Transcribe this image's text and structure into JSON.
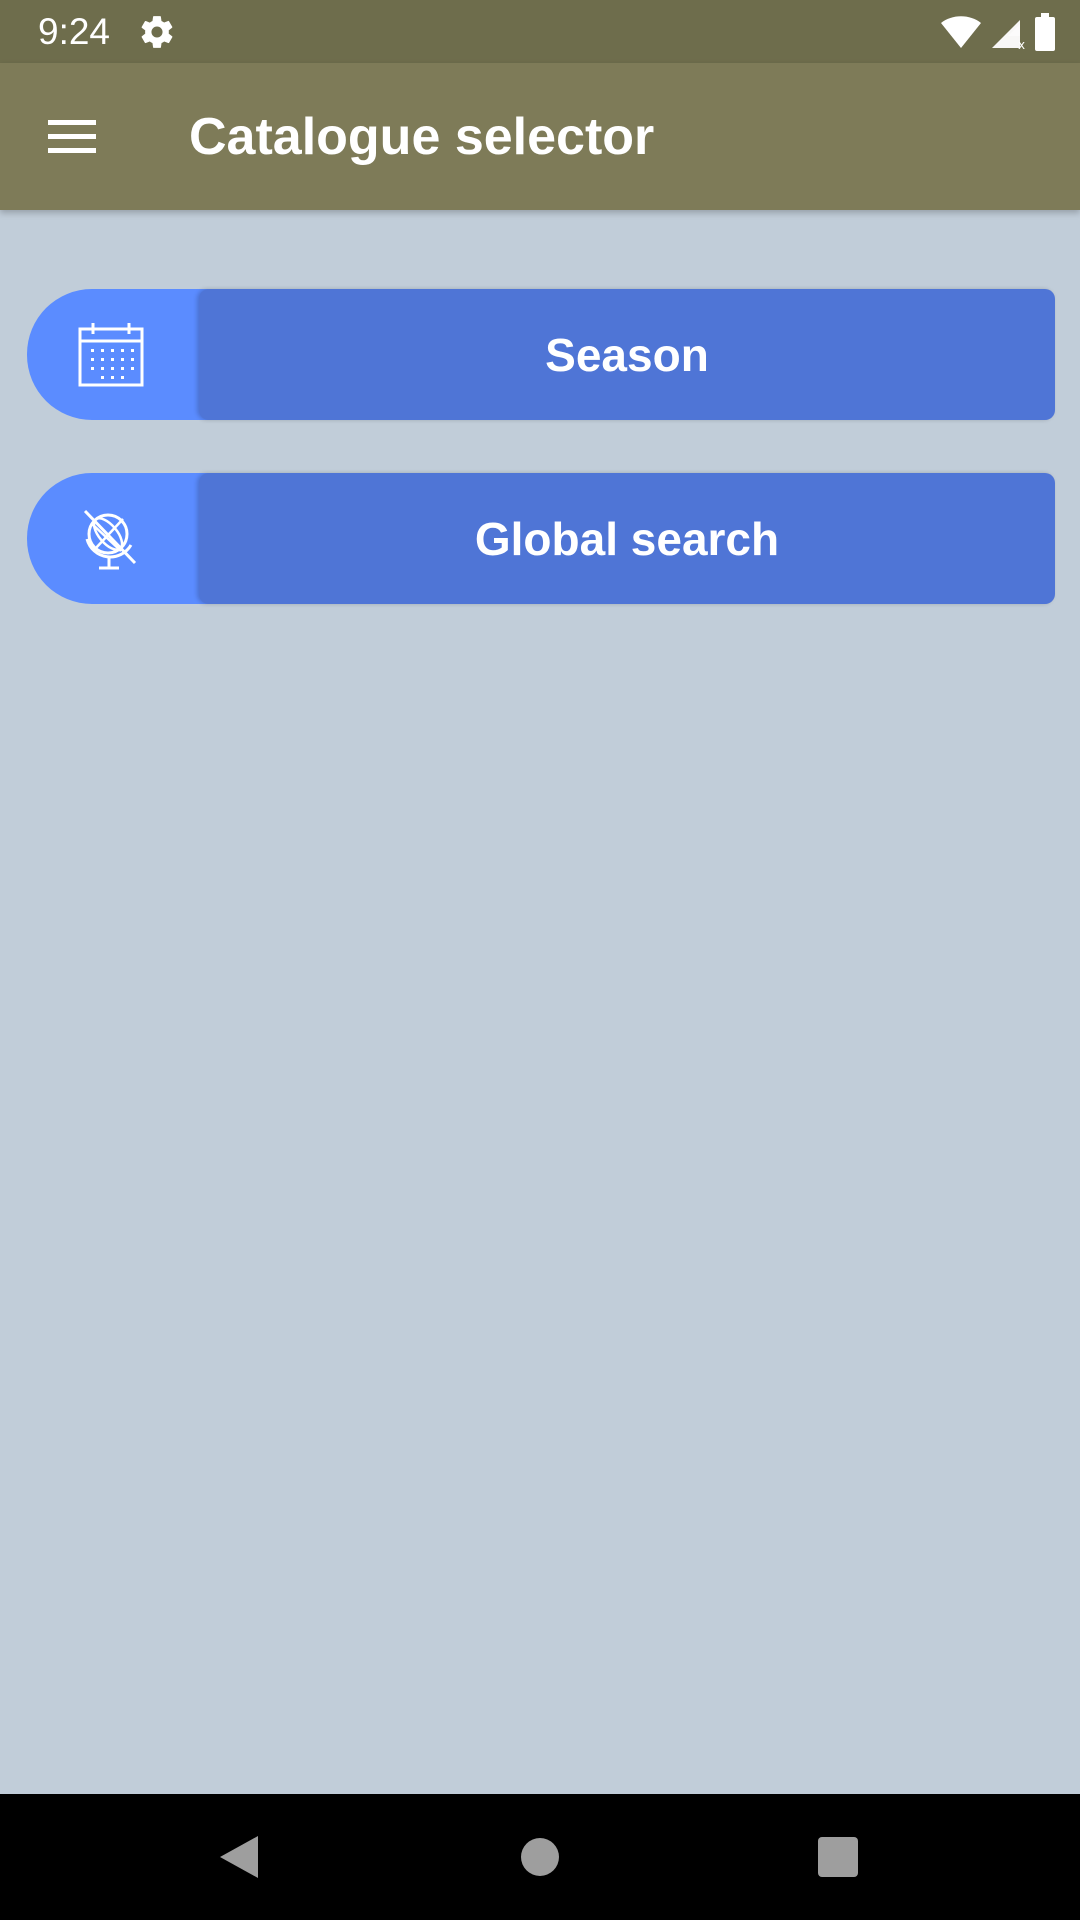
{
  "status_bar": {
    "time": "9:24",
    "icons": [
      "gear-icon",
      "wifi-icon",
      "signal-icon",
      "battery-icon"
    ]
  },
  "app_bar": {
    "title": "Catalogue selector",
    "menu_icon": "hamburger-menu-icon"
  },
  "buttons": [
    {
      "label": "Season",
      "icon": "calendar-icon"
    },
    {
      "label": "Global search",
      "icon": "globe-icon"
    }
  ],
  "nav_bar": {
    "icons": [
      "back-icon",
      "home-icon",
      "recents-icon"
    ]
  },
  "colors": {
    "status_bar": "#6e6d4c",
    "app_bar": "#7e7b58",
    "background": "#c1cdd9",
    "button_icon_bg": "#5b8cff",
    "button_label_bg": "#4f75d6"
  }
}
